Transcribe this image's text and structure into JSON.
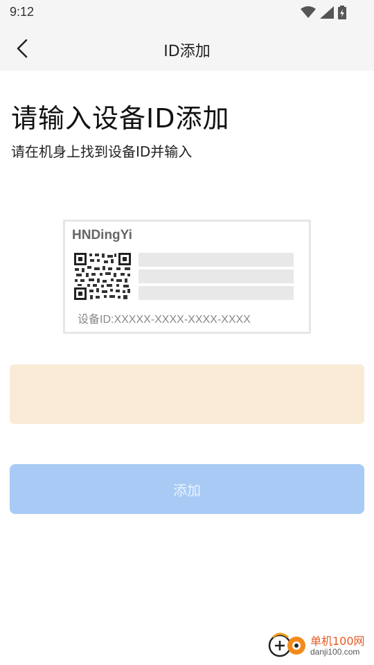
{
  "status_bar": {
    "time": "9:12",
    "icons": [
      "wifi-icon",
      "signal-icon",
      "battery-icon"
    ]
  },
  "app_bar": {
    "back_icon": "chevron-left-icon",
    "title": "ID添加"
  },
  "main": {
    "heading": "请输入设备ID添加",
    "subheading": "请在机身上找到设备ID并输入"
  },
  "device_card": {
    "brand": "HNDingYi",
    "caption": "设备ID:XXXXX-XXXX-XXXX-XXXX"
  },
  "input_area": {
    "value": "",
    "background": "#faebd7"
  },
  "add_button": {
    "label": "添加",
    "color": "#a8caf4"
  },
  "watermark": {
    "title": "单机100网",
    "subtitle": "danji100.com"
  }
}
